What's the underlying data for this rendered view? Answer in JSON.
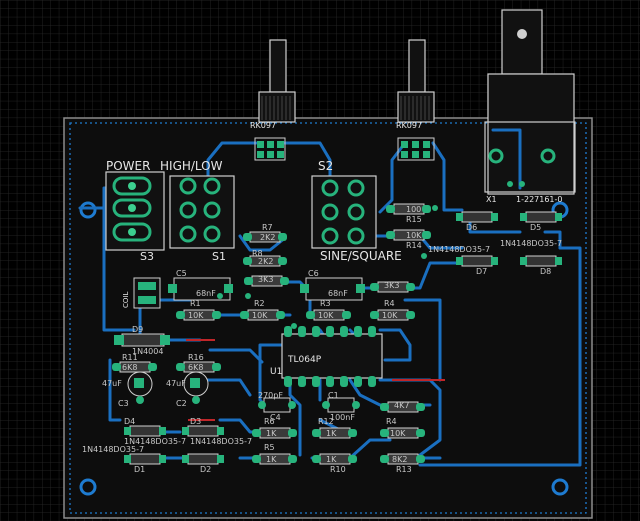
{
  "labels": {
    "power": "POWER",
    "high_low": "HIGH/LOW",
    "s1": "S1",
    "s2": "S2",
    "s3": "S3",
    "sine_square": "SINE/SQUARE",
    "ic": "TL064P",
    "r1": "R1",
    "r2": "R2",
    "r3": "R3",
    "r4": "R4",
    "r5": "R5",
    "r6": "R6",
    "r7": "R7",
    "r8": "R8",
    "r10": "R10",
    "r11": "R11",
    "r12": "R12",
    "r13": "R13",
    "r14": "R14",
    "r15": "R15",
    "r16": "R16",
    "c1": "C1",
    "c2": "C2",
    "c3": "C3",
    "c4": "C4",
    "c5": "C5",
    "c6": "C6",
    "d1": "D1",
    "d2": "D2",
    "d3": "D3",
    "d4": "D4",
    "d5": "D5",
    "d6": "D6",
    "d7": "D7",
    "d8": "D8",
    "d9": "D9",
    "u1": "U1",
    "x1": "X1",
    "pot_left": "RK097",
    "pot_right": "RK097",
    "bnc": "1-227161-0",
    "coil": "COIL",
    "v_10k": "10K",
    "v_1k": "1K",
    "v_2k2": "2K2",
    "v_3k3": "3K3",
    "v_4k7": "4K7",
    "v_6k8": "6K8",
    "v_8k2": "8K2",
    "v_100": "100",
    "v_47uf": "47uF",
    "v_270pf": "270pF",
    "v_68nf": "68nF",
    "v_100nf": "100nF",
    "v_1n4004": "1N4004",
    "v_1n4148": "1N4148DO35-7"
  }
}
